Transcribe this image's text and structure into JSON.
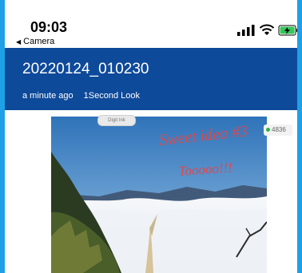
{
  "status": {
    "time": "09:03",
    "back_label": "Camera"
  },
  "header": {
    "title": "20220124_010230",
    "meta": [
      "a minute ago",
      "1Second Look"
    ]
  },
  "photo": {
    "handwriting": [
      "Sweet idea #3",
      "Tooooo!!!"
    ],
    "top_pill": "Digit Ink",
    "badge_count": "4836"
  },
  "colors": {
    "frame": "#1ea0e6",
    "header_bg": "#0e4a9a",
    "ink": "#e0474c"
  }
}
